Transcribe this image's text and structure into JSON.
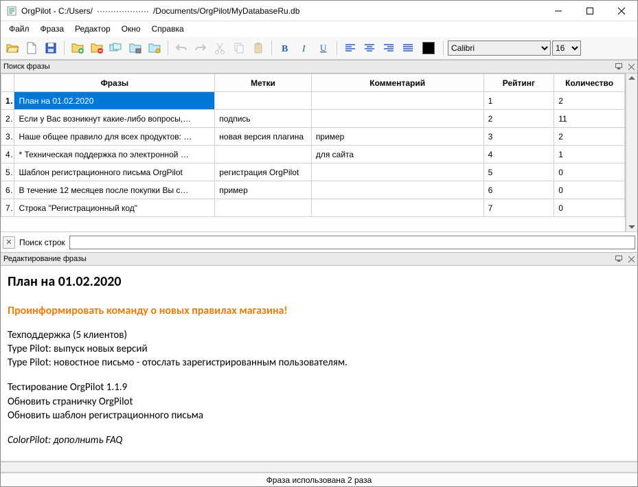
{
  "window": {
    "title_prefix": "OrgPilot - C:/Users/",
    "title_middle": "···················",
    "title_suffix": "/Documents/OrgPilot/MyDatabaseRu.db"
  },
  "menu": {
    "file": "Файл",
    "phrase": "Фраза",
    "editor": "Редактор",
    "window": "Окно",
    "help": "Справка"
  },
  "toolbar": {
    "font_name": "Calibri",
    "font_size": "16"
  },
  "panels": {
    "search_title": "Поиск фразы",
    "editor_title": "Редактирование фразы"
  },
  "grid": {
    "headers": {
      "phrase": "Фразы",
      "tags": "Метки",
      "comment": "Комментарий",
      "rating": "Рейтинг",
      "count": "Количество"
    },
    "rows": [
      {
        "n": "1",
        "phrase": "План на 01.02.2020",
        "tags": "",
        "comment": "",
        "rating": "1",
        "count": "2",
        "selected": true
      },
      {
        "n": "2",
        "phrase": "Если у Вас возникнут какие-либо вопросы,…",
        "tags": "подпись",
        "comment": "",
        "rating": "2",
        "count": "11"
      },
      {
        "n": "3",
        "phrase": "Наше общее правило для всех продуктов: …",
        "tags": "новая версия плагина",
        "comment": "пример",
        "rating": "3",
        "count": "2"
      },
      {
        "n": "4",
        "phrase": "* Техническая поддержка по электронной …",
        "tags": "",
        "comment": "для сайта",
        "rating": "4",
        "count": "1"
      },
      {
        "n": "5",
        "phrase": "Шаблон регистрационного письма OrgPilot",
        "tags": "регистрация OrgPilot",
        "comment": "",
        "rating": "5",
        "count": "0"
      },
      {
        "n": "6",
        "phrase": "В течение 12 месяцев после покупки Вы с…",
        "tags": "пример",
        "comment": "",
        "rating": "6",
        "count": "0"
      },
      {
        "n": "7",
        "phrase": "Строка \"Регистрационный код\"",
        "tags": "",
        "comment": "",
        "rating": "7",
        "count": "0"
      }
    ]
  },
  "search": {
    "label": "Поиск строк",
    "value": ""
  },
  "editor": {
    "title": "План на 01.02.2020",
    "highlight": "Проинформировать команду о новых правилах магазина!",
    "l1": "Техподдержка (5 клиентов)",
    "l2": "Type Pilot: выпуск новых версий",
    "l3": "Type Pilot: новостное письмо - отослать зарегистрированным пользователям.",
    "l4": "Тестирование OrgPilot 1.1.9",
    "l5": "Обновить страничку OrgPilot",
    "l6": "Обновить шаблон регистрационного письма",
    "l7": "ColorPilot: дополнить FAQ"
  },
  "status": {
    "text": "Фраза использована 2 раза"
  }
}
